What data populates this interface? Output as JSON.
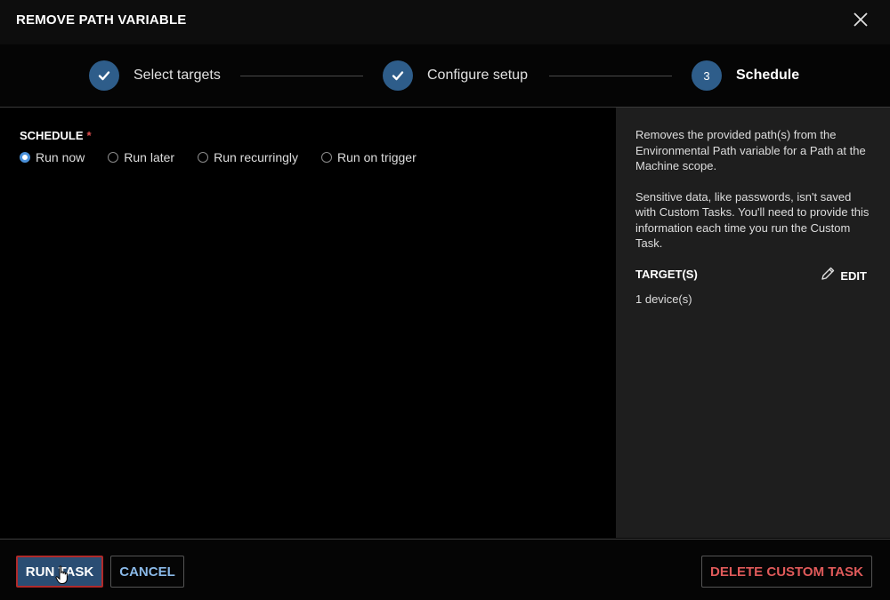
{
  "header": {
    "title": "REMOVE PATH VARIABLE"
  },
  "steps": [
    {
      "label": "Select targets",
      "state": "done"
    },
    {
      "label": "Configure setup",
      "state": "done"
    },
    {
      "label": "Schedule",
      "state": "active",
      "number": "3"
    }
  ],
  "schedule": {
    "label": "SCHEDULE",
    "required_mark": "*",
    "options": [
      "Run now",
      "Run later",
      "Run recurringly",
      "Run on trigger"
    ],
    "selected": "Run now"
  },
  "aside": {
    "description": "Removes the provided path(s) from the Environmental Path variable for a Path at the Machine scope.",
    "note": "Sensitive data, like passwords, isn't saved with Custom Tasks. You'll need to provide this information each time you run the Custom Task.",
    "targets_title": "TARGET(S)",
    "edit_label": "EDIT",
    "targets_count": "1 device(s)"
  },
  "footer": {
    "run_label": "RUN TASK",
    "cancel_label": "CANCEL",
    "delete_label": "DELETE CUSTOM TASK"
  },
  "colors": {
    "accent": "#2e5d8a",
    "radio_checked": "#4a90d9",
    "danger": "#e05a5a",
    "link": "#8ab9e8"
  },
  "icons": {
    "close": "close-icon",
    "step_done": "check-icon",
    "edit": "pencil-icon"
  }
}
